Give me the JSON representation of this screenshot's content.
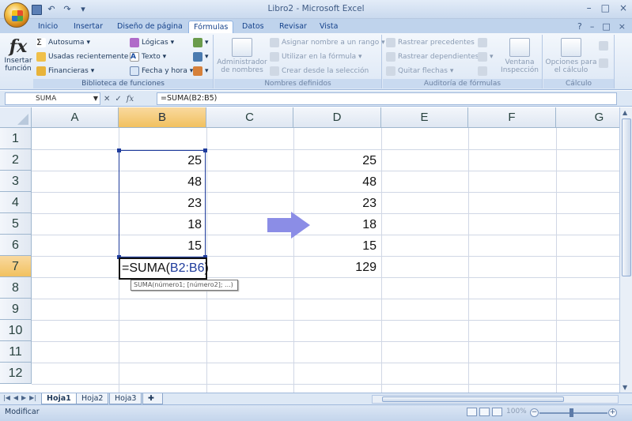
{
  "window": {
    "title": "Libro2 - Microsoft Excel",
    "controls": [
      "–",
      "□",
      "×"
    ]
  },
  "quick_access": {
    "items": [
      "save-icon",
      "undo-icon",
      "redo-icon",
      "customize-icon"
    ],
    "undo": "↶",
    "redo": "↷",
    "customize": "▾"
  },
  "ribbon_tabs": [
    "Inicio",
    "Insertar",
    "Diseño de página",
    "Fórmulas",
    "Datos",
    "Revisar",
    "Vista"
  ],
  "active_tab": "Fórmulas",
  "help_icons": [
    "?",
    "–",
    "□",
    "×"
  ],
  "ribbon": {
    "insert_function": {
      "glyph": "fx",
      "label1": "Insertar",
      "label2": "función"
    },
    "library": {
      "label": "Biblioteca de funciones",
      "autosum": "Autosuma",
      "recent": "Usadas recientemente",
      "financial": "Financieras",
      "logical": "Lógicas",
      "text": "Texto",
      "datetime": "Fecha y hora"
    },
    "names": {
      "label": "Nombres definidos",
      "manager1": "Administrador",
      "manager2": "de nombres",
      "assign": "Asignar nombre a un rango",
      "use": "Utilizar en la fórmula",
      "create": "Crear desde la selección"
    },
    "audit": {
      "label": "Auditoría de fórmulas",
      "precedents": "Rastrear precedentes",
      "dependents": "Rastrear dependientes",
      "remove": "Quitar flechas",
      "window1": "Ventana",
      "window2": "Inspección"
    },
    "calc": {
      "label": "Cálculo",
      "options1": "Opciones para",
      "options2": "el cálculo"
    }
  },
  "formula_bar": {
    "name_box": "SUMA",
    "cancel": "✕",
    "enter": "✓",
    "fx": "fx",
    "content": "=SUMA(B2:B5)"
  },
  "columns": [
    "A",
    "B",
    "C",
    "D",
    "E",
    "F",
    "G"
  ],
  "rows": [
    "1",
    "2",
    "3",
    "4",
    "5",
    "6",
    "7",
    "8",
    "9",
    "10",
    "11",
    "12"
  ],
  "selected_column": "B",
  "selected_row": "7",
  "cells": {
    "B2": "25",
    "B3": "48",
    "B4": "23",
    "B5": "18",
    "B6": "15",
    "D2": "25",
    "D3": "48",
    "D4": "23",
    "D5": "18",
    "D6": "15",
    "D7": "129"
  },
  "editing_cell": {
    "prefix": "=SUMA(",
    "ref": "B2:B6",
    "suffix": ")"
  },
  "tooltip": "SUMA(número1; [número2]; ...)",
  "sheets": [
    "Hoja1",
    "Hoja2",
    "Hoja3"
  ],
  "active_sheet": "Hoja1",
  "status": {
    "mode": "Modificar",
    "zoom": "100%"
  },
  "colors": {
    "ribbon_bg": "#dce7f5",
    "selection_header": "#f1c15f",
    "range_border": "#1f3c9c",
    "arrow_fill": "#8b8de6"
  }
}
